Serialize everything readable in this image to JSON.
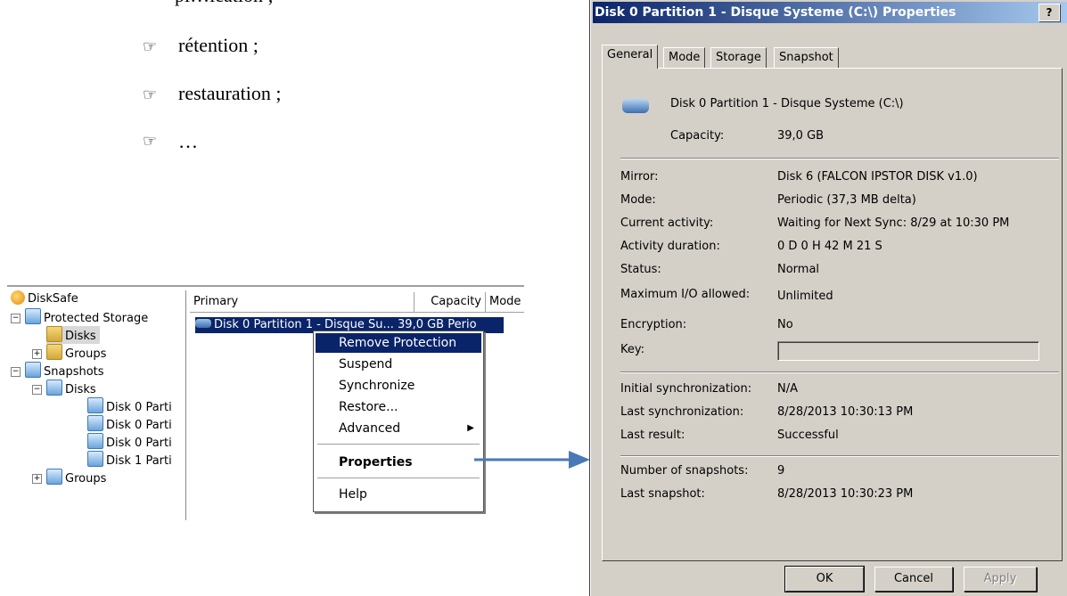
{
  "document": {
    "bullet_icon": "pointing-hand-icon",
    "items": [
      "rétention ;",
      "restauration ;",
      "…"
    ]
  },
  "tree": {
    "root": "DiskSafe",
    "protected_storage": "Protected Storage",
    "disks": "Disks",
    "groups": "Groups",
    "snapshots": "Snapshots",
    "snap_disks": "Disks",
    "snap_children": [
      "Disk 0 Parti",
      "Disk 0 Parti",
      "Disk 0 Parti",
      "Disk 1 Parti"
    ],
    "snap_groups": "Groups"
  },
  "list": {
    "columns": [
      "Primary",
      "Capacity",
      "Mode"
    ],
    "selected_row": "Disk 0 Partition 1 - Disque Su...   39,0 GB   Perio"
  },
  "context_menu": {
    "items": [
      "Remove Protection",
      "Suspend",
      "Synchronize",
      "Restore...",
      "Advanced",
      "Properties",
      "Help"
    ]
  },
  "dialog": {
    "title": "Disk 0 Partition 1 - Disque Systeme (C:\\) Properties",
    "help_label": "?",
    "tabs": [
      "General",
      "Mode",
      "Storage",
      "Snapshot"
    ],
    "disk_name": "Disk 0 Partition 1 - Disque Systeme (C:\\)",
    "capacity_label": "Capacity:",
    "capacity_value": "39,0 GB",
    "fields": [
      {
        "label": "Mirror:",
        "value": "Disk 6 (FALCON IPSTOR DISK v1.0)"
      },
      {
        "label": "Mode:",
        "value": "Periodic (37,3 MB delta)"
      },
      {
        "label": "Current activity:",
        "value": "Waiting for Next Sync: 8/29 at 10:30 PM"
      },
      {
        "label": "Activity duration:",
        "value": "0 D 0 H 42 M 21 S"
      },
      {
        "label": "Status:",
        "value": "Normal"
      },
      {
        "label": "Maximum I/O allowed:",
        "value": "Unlimited"
      },
      {
        "label": "Encryption:",
        "value": "No"
      },
      {
        "label": "Key:",
        "value": ""
      }
    ],
    "sync_fields": [
      {
        "label": "Initial synchronization:",
        "value": "N/A"
      },
      {
        "label": "Last synchronization:",
        "value": "8/28/2013 10:30:13 PM"
      },
      {
        "label": "Last result:",
        "value": "Successful"
      }
    ],
    "snap_fields": [
      {
        "label": "Number of snapshots:",
        "value": "9"
      },
      {
        "label": "Last snapshot:",
        "value": "8/28/2013 10:30:23 PM"
      }
    ],
    "buttons": {
      "ok": "OK",
      "cancel": "Cancel",
      "apply": "Apply"
    }
  },
  "colors": {
    "selection": "#0a246a",
    "dialog_bg": "#d4d0c8",
    "arrow": "#4a7ab5"
  }
}
